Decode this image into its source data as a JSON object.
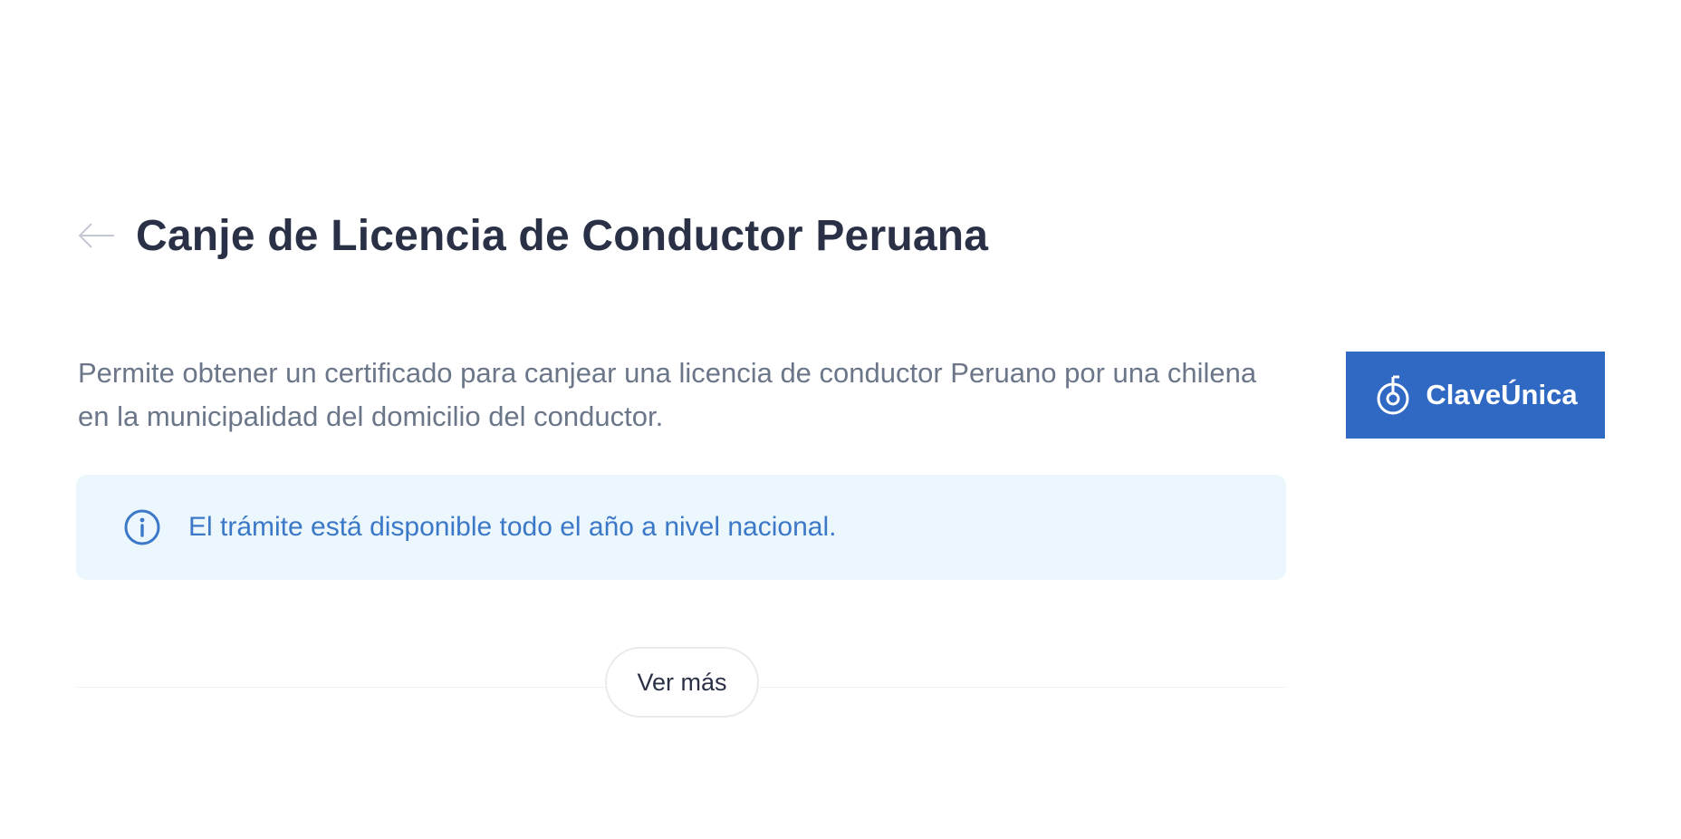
{
  "header": {
    "title": "Canje de Licencia de Conductor Peruana",
    "back_icon": "arrow-left-icon"
  },
  "description": {
    "text": "Permite obtener un certificado para canjear una licencia de conductor Peruano por una chilena en la municipalidad del domicilio del conductor."
  },
  "login_button": {
    "label": "ClaveÚnica",
    "icon": "clave-unica-icon",
    "color": "#2f69c3"
  },
  "info_notice": {
    "icon": "info-icon",
    "text": "El trámite está disponible todo el año a nivel nacional.",
    "background": "#ebf6fd",
    "text_color": "#3b78c8"
  },
  "more": {
    "label": "Ver más"
  }
}
